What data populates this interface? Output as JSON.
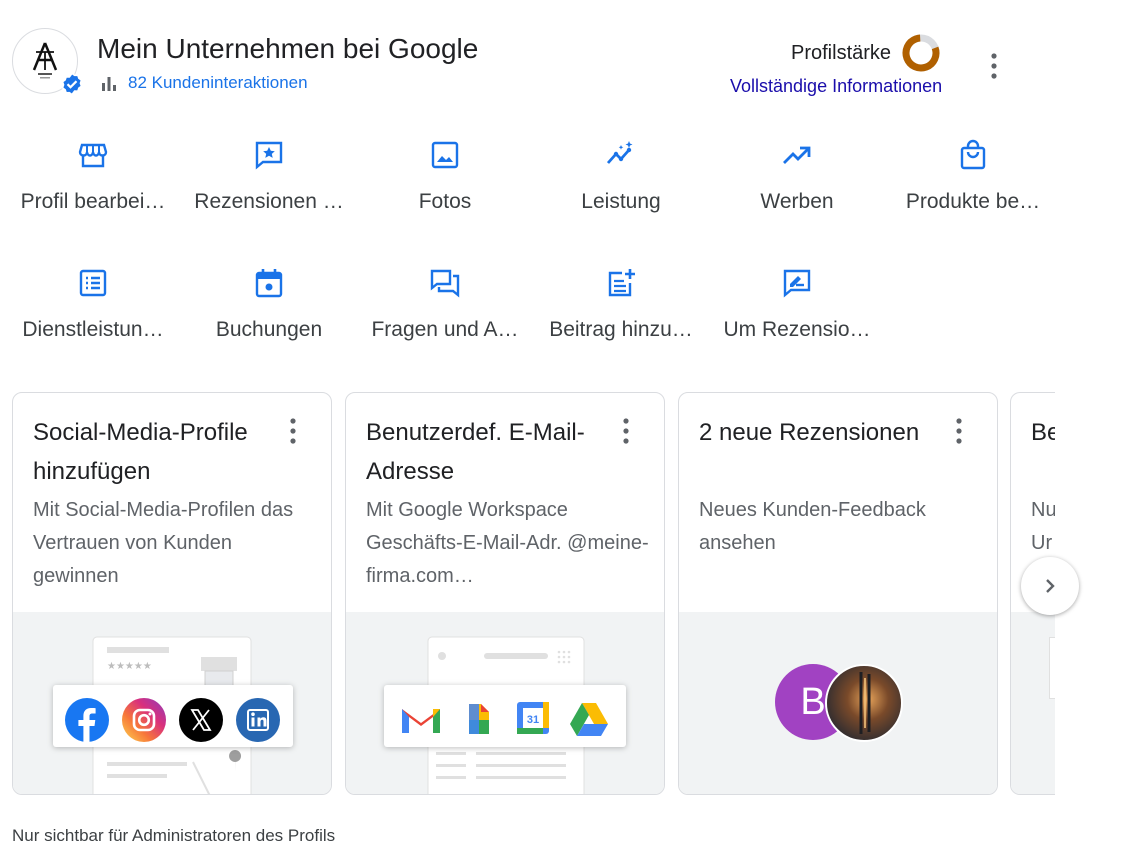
{
  "header": {
    "title": "Mein Unternehmen bei Google",
    "interactions": "82 Kundeninteraktionen",
    "strength_label": "Profilstärke",
    "full_info_link": "Vollständige Informationen",
    "logo_text": "ÅŤ",
    "accent": "#1a73e8"
  },
  "actions_row1": [
    {
      "label": "Profil bearbei…",
      "icon": "storefront-icon"
    },
    {
      "label": "Rezensionen …",
      "icon": "review-star-icon"
    },
    {
      "label": "Fotos",
      "icon": "photo-icon"
    },
    {
      "label": "Leistung",
      "icon": "performance-icon"
    },
    {
      "label": "Werben",
      "icon": "trending-up-icon"
    },
    {
      "label": "Produkte be…",
      "icon": "shopping-bag-icon"
    }
  ],
  "actions_row2": [
    {
      "label": "Dienstleistun…",
      "icon": "list-icon"
    },
    {
      "label": "Buchungen",
      "icon": "calendar-icon"
    },
    {
      "label": "Fragen und A…",
      "icon": "forum-icon"
    },
    {
      "label": "Beitrag hinzu…",
      "icon": "post-add-icon"
    },
    {
      "label": "Um Rezensio…",
      "icon": "rate-review-icon"
    }
  ],
  "cards": [
    {
      "title": "Social-Media-Profile hinzufügen",
      "desc": "Mit Social-Media-Profilen das Vertrauen von Kunden gewinnen"
    },
    {
      "title": "Benutzerdef. E-Mail-Adresse",
      "desc": "Mit Google Workspace Geschäfts-E-Mail-Adr. @meine-firma.com…"
    },
    {
      "title": "2 neue Rezensionen",
      "desc": "Neues Kunden-Feedback ansehen",
      "avatar_letter": "B"
    },
    {
      "title": "Be",
      "desc": "Nu Ur"
    }
  ],
  "footnote": "Nur sichtbar für Administratoren des Profils"
}
